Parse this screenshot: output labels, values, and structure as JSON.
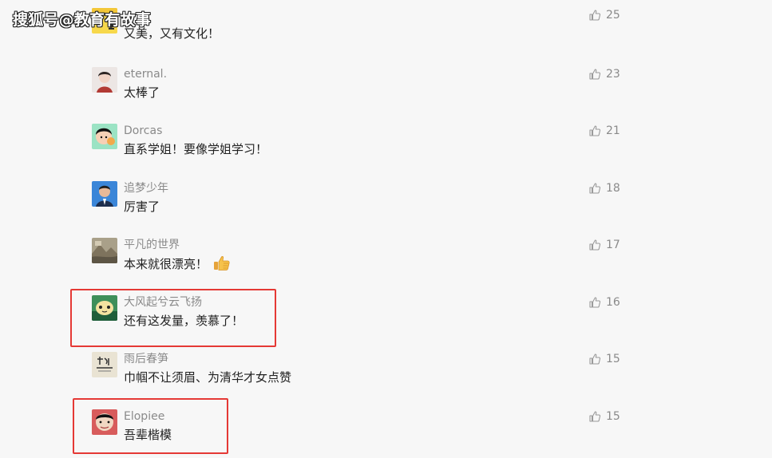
{
  "watermark": {
    "text": "搜狐号@教育有故事"
  },
  "comments": [
    {
      "username": "",
      "text": "又美，又有文化！",
      "likes": "25",
      "avatar_icon": "yellow-avatar"
    },
    {
      "username": "eternal.",
      "text": "太棒了",
      "likes": "23",
      "avatar_icon": "woman-portrait-avatar"
    },
    {
      "username": "Dorcas",
      "text": "直系学姐！要像学姐学习！",
      "likes": "21",
      "avatar_icon": "cartoon-girl-avatar"
    },
    {
      "username": "追梦少年",
      "text": "厉害了",
      "likes": "18",
      "avatar_icon": "man-portrait-avatar"
    },
    {
      "username": "平凡的世界",
      "text": "本来就很漂亮！",
      "likes": "17",
      "avatar_icon": "landscape-avatar",
      "has_thumb_emoji": true
    },
    {
      "username": "大风起兮云飞扬",
      "text": "还有这发量，羡慕了！",
      "likes": "16",
      "avatar_icon": "cartoon-animal-avatar",
      "highlighted": true
    },
    {
      "username": "雨后春笋",
      "text": "巾帼不让须眉、为清华才女点赞",
      "likes": "15",
      "avatar_icon": "calligraphy-avatar"
    },
    {
      "username": "Elopiee",
      "text": "吾辈楷模",
      "likes": "15",
      "avatar_icon": "cartoon-boy-avatar",
      "highlighted": true
    }
  ],
  "colors": {
    "background": "#f7f7f7",
    "username": "#8a8a8a",
    "comment_text": "#222222",
    "highlight": "#e53935"
  },
  "icons": {
    "like": "thumbs-up-outline-icon"
  }
}
